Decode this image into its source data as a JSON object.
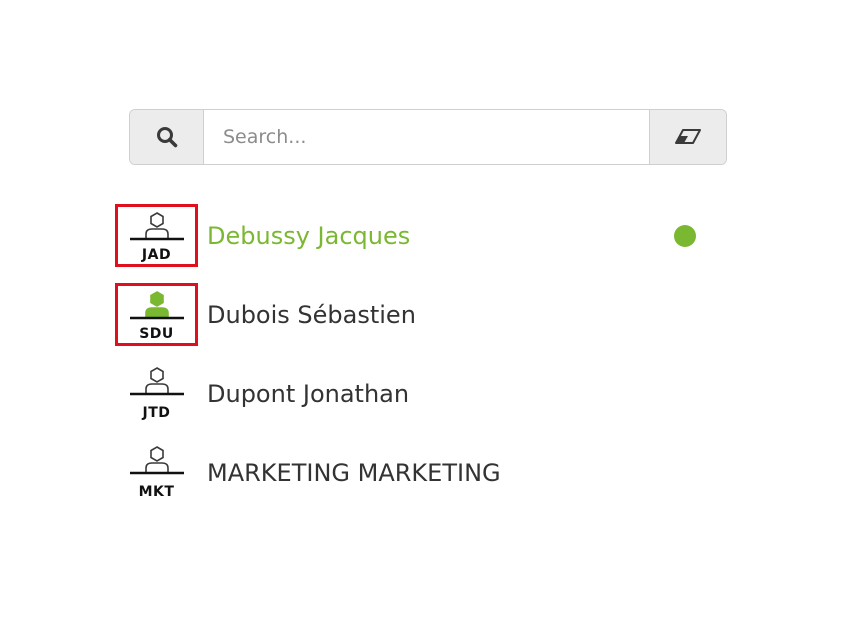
{
  "search": {
    "placeholder": "Search...",
    "value": "",
    "search_icon": "search-icon",
    "clear_icon": "eraser-icon"
  },
  "colors": {
    "active": "#7ab832",
    "selection_border": "#e00f1e",
    "text": "#333333",
    "button_bg": "#ececec"
  },
  "users": [
    {
      "initials": "JAD",
      "name": "Debussy Jacques",
      "selected": true,
      "active": true,
      "avatar_filled": false,
      "status_online": true
    },
    {
      "initials": "SDU",
      "name": "Dubois Sébastien",
      "selected": true,
      "active": false,
      "avatar_filled": true,
      "status_online": false
    },
    {
      "initials": "JTD",
      "name": "Dupont Jonathan",
      "selected": false,
      "active": false,
      "avatar_filled": false,
      "status_online": false
    },
    {
      "initials": "MKT",
      "name": "MARKETING MARKETING",
      "selected": false,
      "active": false,
      "avatar_filled": false,
      "status_online": false
    }
  ]
}
